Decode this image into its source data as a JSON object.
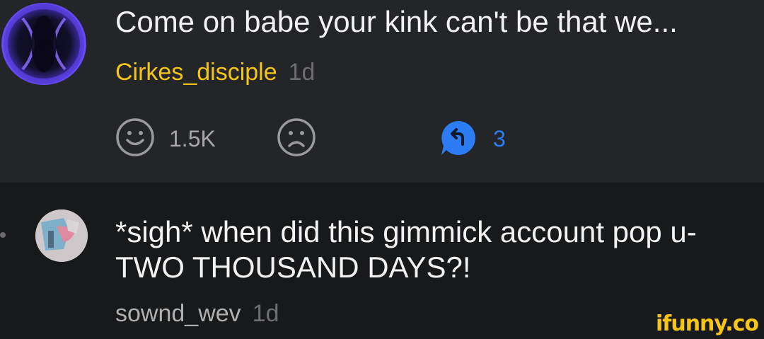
{
  "comments": [
    {
      "text": "Come on babe your kink can't be that we...",
      "author": "Cirkes_disciple",
      "time": "1d",
      "smile_count": "1.5K",
      "reply_count": "3"
    },
    {
      "text": "*sigh* when did this gimmick account pop u-TWO THOUSAND DAYS?!",
      "author": "sownd_wev",
      "time": "1d"
    }
  ],
  "icons": {
    "smile": "smile-icon",
    "unsmile": "unsmile-icon",
    "reply": "reply-icon"
  },
  "colors": {
    "author_highlight": "#f5c518",
    "reply_accent": "#2c7cf4",
    "top_background": "#242528",
    "bottom_background": "#18191b"
  },
  "watermark": "ifunny.co"
}
